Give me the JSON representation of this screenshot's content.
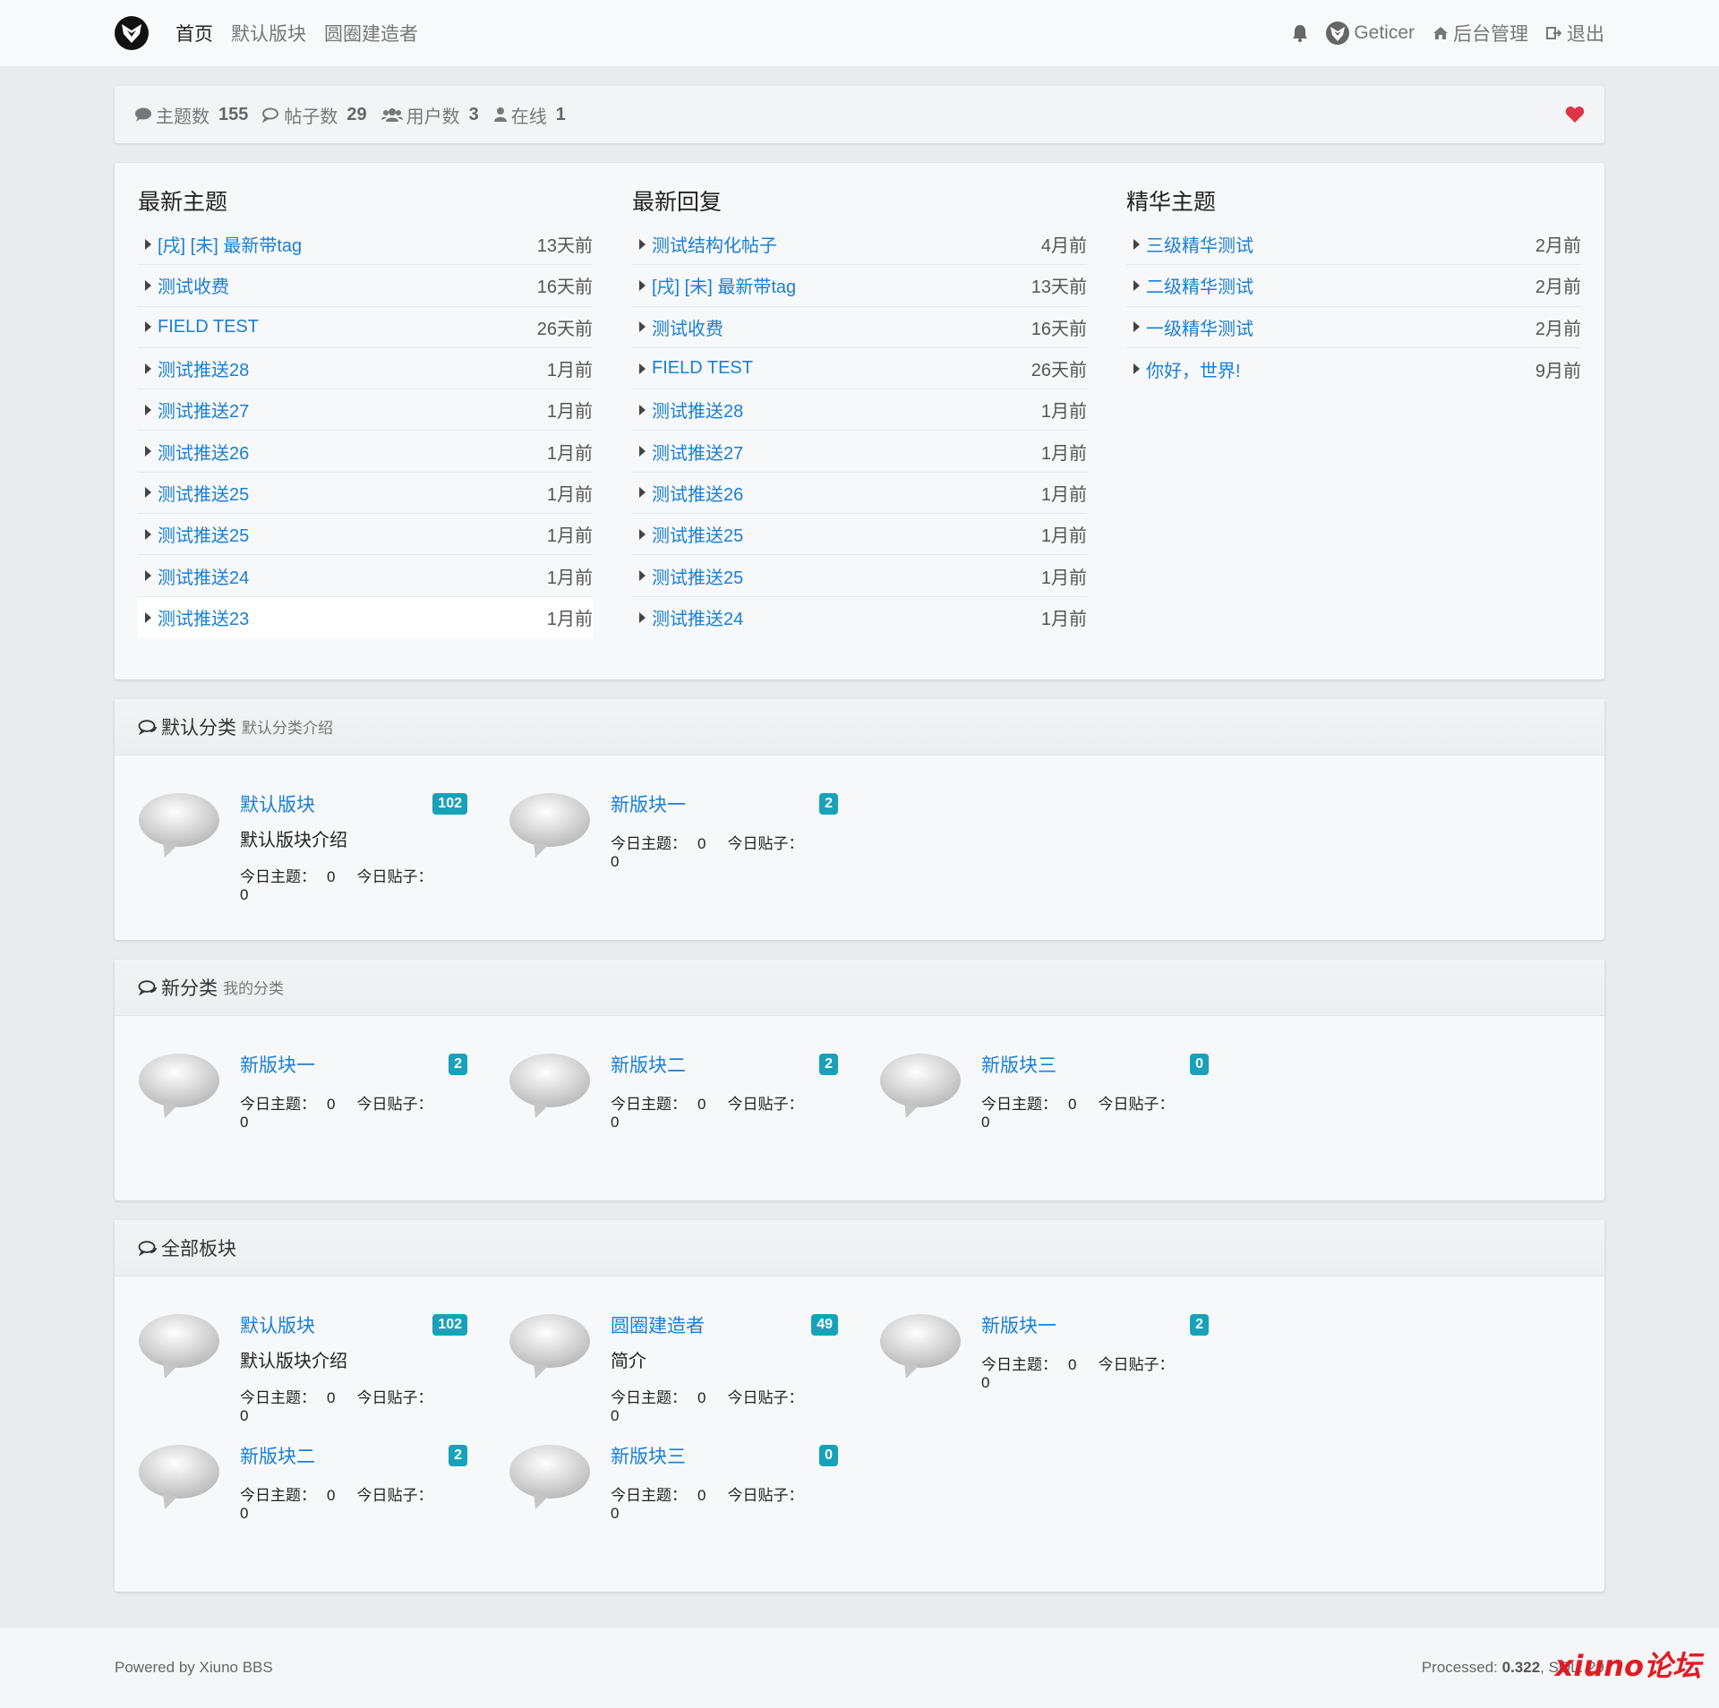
{
  "nav": {
    "items": [
      "首页",
      "默认版块",
      "圆圈建造者"
    ],
    "user": "Geticer",
    "admin": "后台管理",
    "logout": "退出"
  },
  "stats": {
    "threads_label": "主题数",
    "threads": "155",
    "posts_label": "帖子数",
    "posts": "29",
    "users_label": "用户数",
    "users": "3",
    "online_label": "在线",
    "online": "1"
  },
  "lists": [
    {
      "title": "最新主题",
      "rows": [
        {
          "text": "[戌] [未] 最新带tag",
          "time": "13天前"
        },
        {
          "text": "测试收费",
          "time": "16天前"
        },
        {
          "text": "FIELD TEST",
          "time": "26天前"
        },
        {
          "text": "测试推送28",
          "time": "1月前"
        },
        {
          "text": "测试推送27",
          "time": "1月前"
        },
        {
          "text": "测试推送26",
          "time": "1月前"
        },
        {
          "text": "测试推送25",
          "time": "1月前"
        },
        {
          "text": "测试推送25",
          "time": "1月前"
        },
        {
          "text": "测试推送24",
          "time": "1月前"
        },
        {
          "text": "测试推送23",
          "time": "1月前"
        }
      ]
    },
    {
      "title": "最新回复",
      "rows": [
        {
          "text": "测试结构化帖子",
          "time": "4月前"
        },
        {
          "text": "[戌] [未] 最新带tag",
          "time": "13天前"
        },
        {
          "text": "测试收费",
          "time": "16天前"
        },
        {
          "text": "FIELD TEST",
          "time": "26天前"
        },
        {
          "text": "测试推送28",
          "time": "1月前"
        },
        {
          "text": "测试推送27",
          "time": "1月前"
        },
        {
          "text": "测试推送26",
          "time": "1月前"
        },
        {
          "text": "测试推送25",
          "time": "1月前"
        },
        {
          "text": "测试推送25",
          "time": "1月前"
        },
        {
          "text": "测试推送24",
          "time": "1月前"
        }
      ]
    },
    {
      "title": "精华主题",
      "rows": [
        {
          "text": "三级精华测试",
          "time": "2月前"
        },
        {
          "text": "二级精华测试",
          "time": "2月前"
        },
        {
          "text": "一级精华测试",
          "time": "2月前"
        },
        {
          "text": "你好，世界!",
          "time": "9月前"
        }
      ]
    }
  ],
  "today_threads_label": "今日主题：",
  "today_posts_label": "今日贴子：",
  "categories": [
    {
      "name": "默认分类",
      "desc": "默认分类介绍",
      "forums": [
        {
          "name": "默认版块",
          "count": "102",
          "desc": "默认版块介绍",
          "today_threads": "0",
          "today_posts": "0"
        },
        {
          "name": "新版块一",
          "count": "2",
          "desc": "",
          "today_threads": "0",
          "today_posts": "0"
        }
      ]
    },
    {
      "name": "新分类",
      "desc": "我的分类",
      "forums": [
        {
          "name": "新版块一",
          "count": "2",
          "desc": "",
          "today_threads": "0",
          "today_posts": "0"
        },
        {
          "name": "新版块二",
          "count": "2",
          "desc": "",
          "today_threads": "0",
          "today_posts": "0"
        },
        {
          "name": "新版块三",
          "count": "0",
          "desc": "",
          "today_threads": "0",
          "today_posts": "0"
        }
      ]
    },
    {
      "name": "全部板块",
      "desc": "",
      "forums": [
        {
          "name": "默认版块",
          "count": "102",
          "desc": "默认版块介绍",
          "today_threads": "0",
          "today_posts": "0"
        },
        {
          "name": "圆圈建造者",
          "count": "49",
          "desc": "简介",
          "today_threads": "0",
          "today_posts": "0"
        },
        {
          "name": "新版块一",
          "count": "2",
          "desc": "",
          "today_threads": "0",
          "today_posts": "0"
        },
        {
          "name": "新版块二",
          "count": "2",
          "desc": "",
          "today_threads": "0",
          "today_posts": "0"
        },
        {
          "name": "新版块三",
          "count": "0",
          "desc": "",
          "today_threads": "0",
          "today_posts": "0"
        }
      ]
    }
  ],
  "footer": {
    "powered": "Powered by Xiuno BBS",
    "processed_label": "Processed:",
    "processed": "0.322",
    "sql_label": ", SQL: 29",
    "watermark": "xiuno论坛"
  },
  "colors": {
    "link": "#1a7fd4",
    "badge": "#17a2b8",
    "heart": "#dc3545",
    "watermark": "#e21b23"
  }
}
